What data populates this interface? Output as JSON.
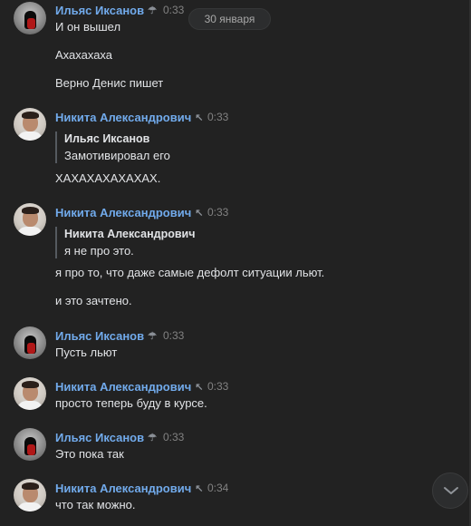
{
  "date_separator": "30 января",
  "messages": [
    {
      "author": "Ильяс Иксанов",
      "badge": "☂",
      "time": "0:33",
      "lines": [
        "И он вышел",
        "Ахахахаха",
        "Верно Денис пишет"
      ]
    },
    {
      "author": "Никита Александрович",
      "badge": "↖",
      "time": "0:33",
      "quote": {
        "author": "Ильяс Иксанов",
        "text": "Замотивировал его"
      },
      "lines": [
        "ХАХАХАХАХАХАХ."
      ]
    },
    {
      "author": "Никита Александрович",
      "badge": "↖",
      "time": "0:33",
      "quote": {
        "author": "Никита Александрович",
        "text": "я не про это."
      },
      "lines": [
        "я про то, что даже самые дефолт ситуации льют.",
        "и это зачтено."
      ]
    },
    {
      "author": "Ильяс Иксанов",
      "badge": "☂",
      "time": "0:33",
      "lines": [
        "Пусть льют"
      ]
    },
    {
      "author": "Никита Александрович",
      "badge": "↖",
      "time": "0:33",
      "lines": [
        "просто теперь буду в курсе."
      ]
    },
    {
      "author": "Ильяс Иксанов",
      "badge": "☂",
      "time": "0:33",
      "lines": [
        "Это пока так"
      ]
    },
    {
      "author": "Никита Александрович",
      "badge": "↖",
      "time": "0:34",
      "lines": [
        "что так можно."
      ]
    }
  ],
  "icons": {
    "scroll_down": "chevron-down-icon"
  }
}
